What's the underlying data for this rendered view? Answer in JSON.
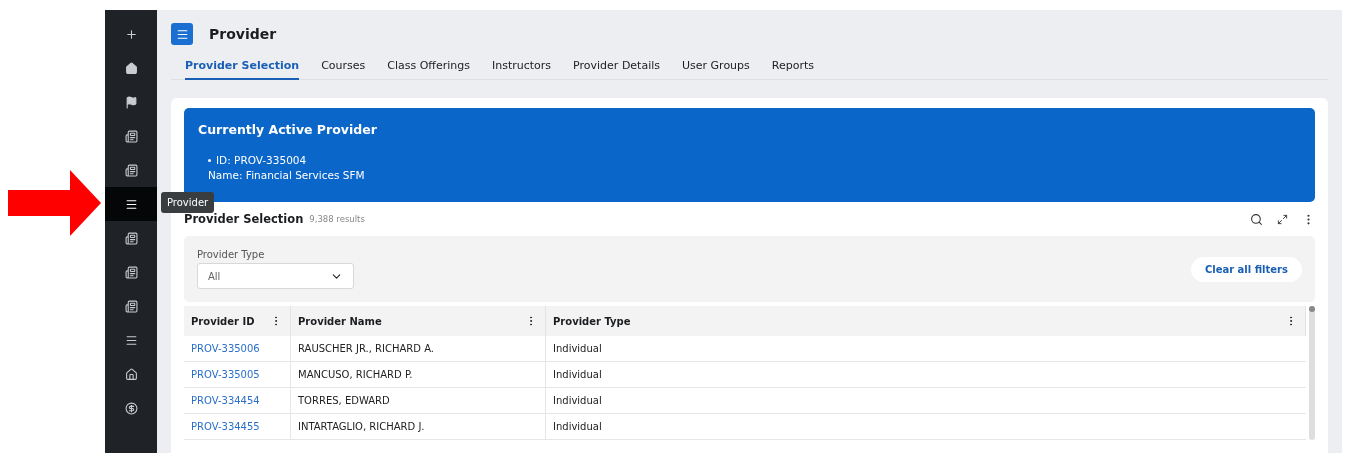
{
  "sidebar": {
    "items": [
      {
        "kind": "plus",
        "selected": false
      },
      {
        "kind": "home",
        "selected": false
      },
      {
        "kind": "flag",
        "selected": false
      },
      {
        "kind": "report",
        "selected": false
      },
      {
        "kind": "report",
        "selected": false
      },
      {
        "kind": "menu",
        "selected": true,
        "tooltip": "Provider"
      },
      {
        "kind": "report",
        "selected": false
      },
      {
        "kind": "report",
        "selected": false
      },
      {
        "kind": "report",
        "selected": false
      },
      {
        "kind": "menu",
        "selected": false
      },
      {
        "kind": "house",
        "selected": false
      },
      {
        "kind": "coin",
        "selected": false
      }
    ]
  },
  "header": {
    "title": "Provider"
  },
  "tabs": [
    {
      "label": "Provider Selection",
      "selected": true
    },
    {
      "label": "Courses",
      "selected": false
    },
    {
      "label": "Class Offerings",
      "selected": false
    },
    {
      "label": "Instructors",
      "selected": false
    },
    {
      "label": "Provider Details",
      "selected": false
    },
    {
      "label": "User Groups",
      "selected": false
    },
    {
      "label": "Reports",
      "selected": false
    }
  ],
  "active_provider": {
    "title": "Currently Active Provider",
    "details": [
      "ID: PROV-335004",
      "Name: Financial Services SFM"
    ]
  },
  "selection": {
    "title": "Provider Selection",
    "count": "9,388 results"
  },
  "filters": {
    "provider_type": {
      "label": "Provider Type",
      "value": "All"
    },
    "clear": "Clear all filters"
  },
  "table": {
    "columns": [
      "Provider ID",
      "Provider Name",
      "Provider Type"
    ],
    "rows": [
      [
        "PROV-335006",
        "RAUSCHER JR., RICHARD A.",
        "Individual"
      ],
      [
        "PROV-335005",
        "MANCUSO, RICHARD P.",
        "Individual"
      ],
      [
        "PROV-334454",
        "TORRES, EDWARD",
        "Individual"
      ],
      [
        "PROV-334455",
        "INTARTAGLIO, RICHARD J.",
        "Individual"
      ]
    ]
  }
}
